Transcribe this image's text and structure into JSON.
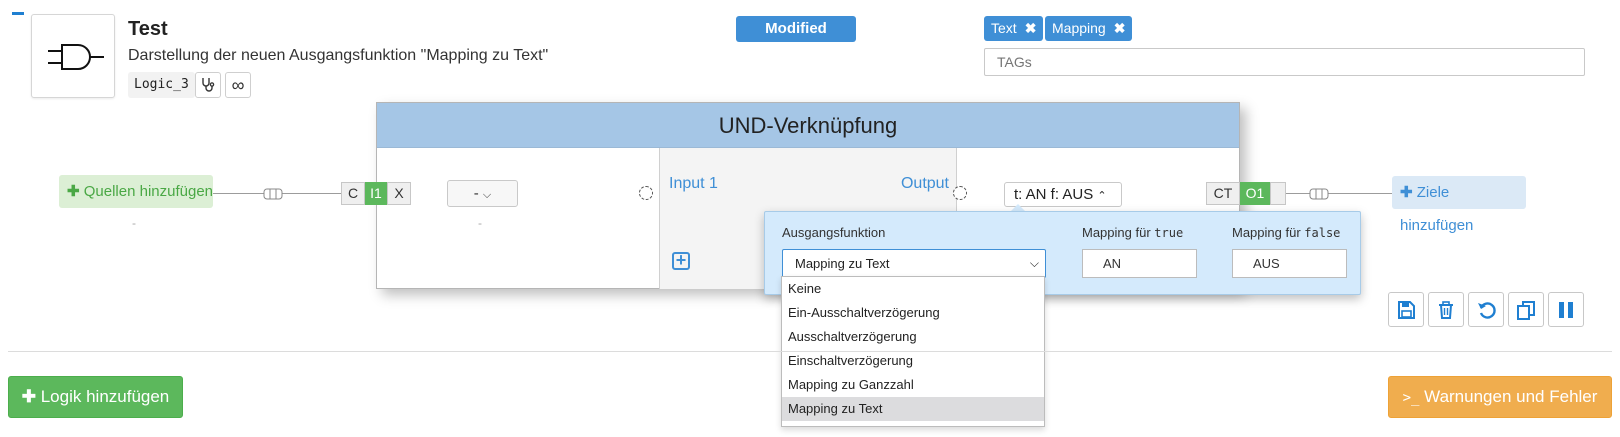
{
  "logic": {
    "title": "Test",
    "description": "Darstellung der neuen Ausgangsfunktion \"Mapping zu Text\"",
    "id": "Logic_3",
    "icon": "and-gate-icon"
  },
  "status_badge": "Modified",
  "tags": {
    "items": [
      "Text",
      "Mapping"
    ],
    "placeholder": "TAGs"
  },
  "sources": {
    "add_label": "Quellen hinzufügen",
    "placeholder": "-"
  },
  "targets": {
    "add_label": "Ziele hinzufügen",
    "placeholder": "-"
  },
  "input_segments": [
    "C",
    "I1",
    "X"
  ],
  "input_dropdown": "-",
  "input_dropdown_caption": "-",
  "block": {
    "title": "UND-Verknüpfung",
    "input_label": "Input 1",
    "output_label": "Output"
  },
  "output_function_button": "t: AN f: AUS",
  "output_segments": [
    "CT",
    "O1",
    ""
  ],
  "popover": {
    "function_label": "Ausgangsfunktion",
    "mapping_true_label": "Mapping für",
    "mapping_true_code": "true",
    "mapping_false_label": "Mapping für",
    "mapping_false_code": "false",
    "selected": "Mapping zu Text",
    "true_value": "AN",
    "false_value": "AUS",
    "options": [
      "Keine",
      "Ein-Ausschaltverzögerung",
      "Ausschaltverzögerung",
      "Einschaltverzögerung",
      "Mapping zu Ganzzahl",
      "Mapping zu Text"
    ]
  },
  "actions": [
    "save-icon",
    "trash-icon",
    "undo-icon",
    "copy-icon",
    "pause-icon"
  ],
  "footer": {
    "add_logic": "Logik hinzufügen",
    "warnings": "Warnungen und Fehler"
  },
  "colors": {
    "primary": "#3f8fd6",
    "success": "#5cb85c",
    "warning": "#f0ad4e",
    "block_header": "#a5c6e6",
    "popover_bg": "#d4eafc"
  }
}
